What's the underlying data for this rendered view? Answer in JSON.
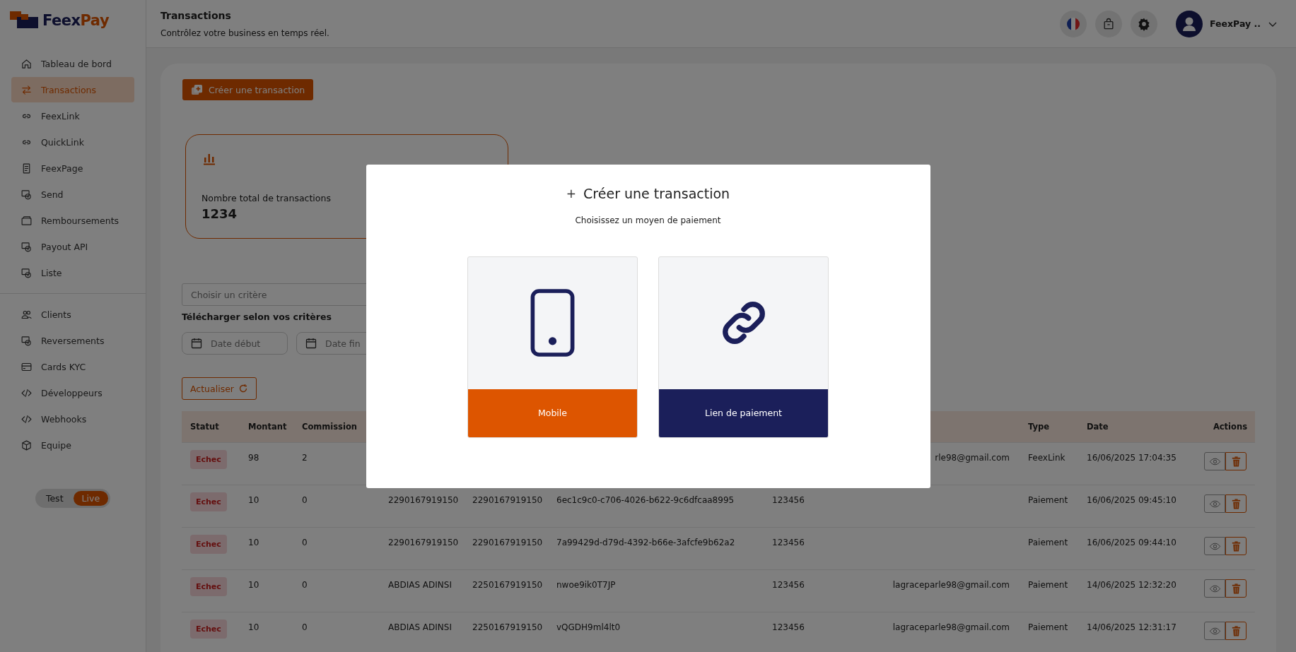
{
  "logo": {
    "parts": [
      "Feex",
      "Pay"
    ]
  },
  "sidebar": {
    "items": [
      {
        "label": "Tableau de bord",
        "kind": "home",
        "selected": false
      },
      {
        "label": "Transactions",
        "kind": "transfer",
        "selected": true
      },
      {
        "label": "FeexLink",
        "kind": "link",
        "selected": false
      },
      {
        "label": "QuickLink",
        "kind": "link",
        "selected": false
      },
      {
        "label": "FeexPage",
        "kind": "page",
        "selected": false
      },
      {
        "label": "Send",
        "kind": "money",
        "selected": false
      },
      {
        "label": "Remboursements",
        "kind": "wallet",
        "selected": false
      },
      {
        "label": "Payout API",
        "kind": "money",
        "selected": false
      },
      {
        "label": "Liste",
        "kind": "money",
        "selected": false
      },
      {
        "kind": "divider"
      },
      {
        "label": "Clients",
        "kind": "users",
        "selected": false
      },
      {
        "label": "Reversements",
        "kind": "money",
        "selected": false
      },
      {
        "label": "Cards KYC",
        "kind": "card",
        "selected": false
      },
      {
        "label": "Développeurs",
        "kind": "code",
        "selected": false
      },
      {
        "label": "Webhooks",
        "kind": "code",
        "selected": false
      },
      {
        "label": "Equipe",
        "kind": "box",
        "selected": false
      }
    ],
    "mode_toggle": [
      {
        "label": "Test",
        "selected": false
      },
      {
        "label": "Live",
        "selected": true
      }
    ]
  },
  "header": {
    "title": "Transactions",
    "subtitle": "Contrôlez votre business en temps réel.",
    "user_name": "FeexPay .."
  },
  "create_button": "Créer une transaction",
  "stat_card": {
    "label": "Nombre total de transactions",
    "value": "1234"
  },
  "filters": {
    "criteria": {
      "placeholder": "Choisir un critère"
    },
    "download_label": "Télécharger selon vos critères",
    "date_start": {
      "placeholder": "Date début"
    },
    "date_end": {
      "placeholder": "Date fin"
    },
    "refresh_button": "Actualiser"
  },
  "table": {
    "columns": {
      "statut": "Statut",
      "montant": "Montant",
      "commission": "Commission",
      "type": "Type",
      "date": "Date",
      "actions": "Actions"
    },
    "rows": [
      {
        "statut": "Echec",
        "montant": "98",
        "commission": "2",
        "column_8": "rle98@gmail.com",
        "type": "FeexLink",
        "date": "16/06/2025 17:04:35"
      },
      {
        "statut": "Echec",
        "montant": "10",
        "commission": "0",
        "column_4": "2290167919150",
        "column_5": "2290167919150",
        "column_6": "6ec1c9c0-c706-4026-b622-9c6dfcaa8995",
        "column_7": "123456",
        "type": "Paiement",
        "date": "16/06/2025 09:45:10"
      },
      {
        "statut": "Echec",
        "montant": "10",
        "commission": "0",
        "column_4": "2290167919150",
        "column_5": "2290167919150",
        "column_6": "7a99429d-d79d-4392-b66e-3afcfe9b62a2",
        "column_7": "123456",
        "type": "Paiement",
        "date": "16/06/2025 09:44:10"
      },
      {
        "statut": "Echec",
        "montant": "10",
        "commission": "0",
        "column_4": "ABDIAS ADINSI",
        "column_5": "2250167919150",
        "column_6": "nwoe9ik0T7JP",
        "column_7": "123456",
        "column_8": "lagraceparle98@gmail.com",
        "type": "Paiement",
        "date": "14/06/2025 12:32:20"
      },
      {
        "statut": "Echec",
        "montant": "10",
        "commission": "0",
        "column_4": "ABDIAS ADINSI",
        "column_5": "2250167919150",
        "column_6": "vQGDH9ml4lt0",
        "column_7": "123456",
        "column_8": "lagraceparle98@gmail.com",
        "type": "Paiement",
        "date": "14/06/2025 12:31:17"
      }
    ]
  },
  "modal": {
    "title_icon": "+",
    "title": "Créer une transaction",
    "subtitle": "Choisissez un moyen de paiement",
    "options": [
      {
        "label": "Mobile",
        "kind": "mobile",
        "color": "#dd5500"
      },
      {
        "label": "Lien de paiement",
        "kind": "link",
        "color": "#1b1f5a"
      }
    ]
  }
}
